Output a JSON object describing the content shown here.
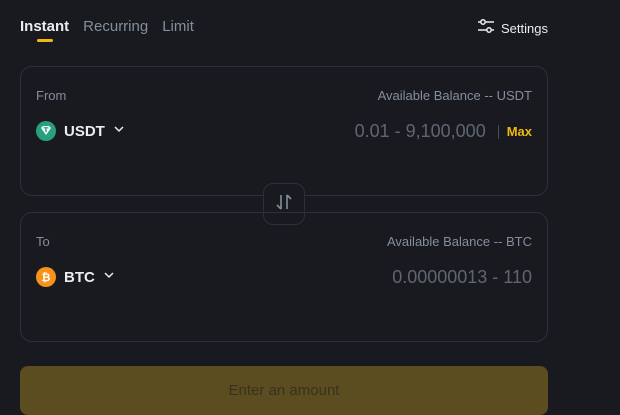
{
  "tabs": [
    {
      "label": "Instant",
      "active": true
    },
    {
      "label": "Recurring",
      "active": false
    },
    {
      "label": "Limit",
      "active": false
    }
  ],
  "settings": {
    "label": "Settings",
    "icon": "sliders-icon"
  },
  "from": {
    "label": "From",
    "balance": "Available Balance -- USDT",
    "coin": "USDT",
    "coin_icon": "tether-icon",
    "coin_color": "#26a17b",
    "placeholder": "0.01 - 9,100,000",
    "max_label": "Max"
  },
  "to": {
    "label": "To",
    "balance": "Available Balance -- BTC",
    "coin": "BTC",
    "coin_icon": "bitcoin-icon",
    "coin_color": "#f7931a",
    "placeholder": "0.00000013 - 110"
  },
  "swap_icon": "swap-arrows-icon",
  "cta": {
    "label": "Enter an amount",
    "color": "#5c4d20"
  },
  "colors": {
    "accent": "#f0b90b",
    "background": "#181a20",
    "border": "#2b3139"
  }
}
